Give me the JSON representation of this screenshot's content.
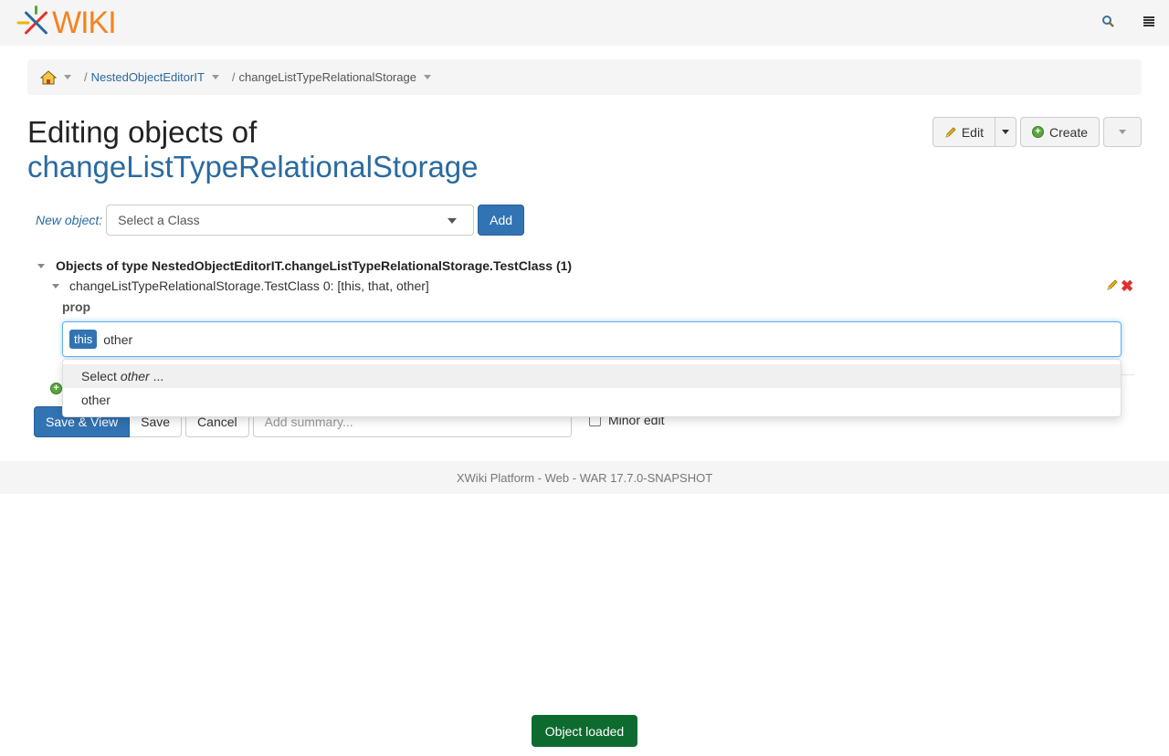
{
  "header": {
    "logo_text": "WIKI",
    "search_icon": "search-icon",
    "menu_icon": "menu-icon"
  },
  "breadcrumb": {
    "home_icon": "home-icon",
    "items": [
      "NestedObjectEditorIT",
      "changeListTypeRelationalStorage"
    ],
    "separator": "/"
  },
  "page": {
    "title_prefix": "Editing objects of",
    "document_name": "changeListTypeRelationalStorage"
  },
  "actions": {
    "edit_label": "Edit",
    "create_label": "Create"
  },
  "new_object": {
    "label": "New object:",
    "select_value": "Select a Class",
    "add_label": "Add"
  },
  "objects": {
    "header": "Objects of type NestedObjectEditorIT.changeListTypeRelationalStorage.TestClass (1)",
    "object_summary": "changeListTypeRelationalStorage.TestClass 0: [this, that, other]",
    "property_label": "prop",
    "selected_tag": "this",
    "typed_text": "other"
  },
  "suggestions": {
    "select_prefix": "Select ",
    "select_value": "other",
    "select_suffix": " ...",
    "option": "other"
  },
  "savebar": {
    "save_view_label": "Save & View",
    "save_label": "Save",
    "cancel_label": "Cancel",
    "summary_placeholder": "Add summary...",
    "minor_edit_label": "Minor edit"
  },
  "footer": {
    "text": "XWiki Platform - Web - WAR 17.7.0-SNAPSHOT"
  },
  "notification": {
    "text": "Object loaded"
  },
  "colors": {
    "primary": "#3273b3",
    "link": "#2a6aa0",
    "success": "#0e6b30",
    "logo_orange": "#f58220"
  }
}
